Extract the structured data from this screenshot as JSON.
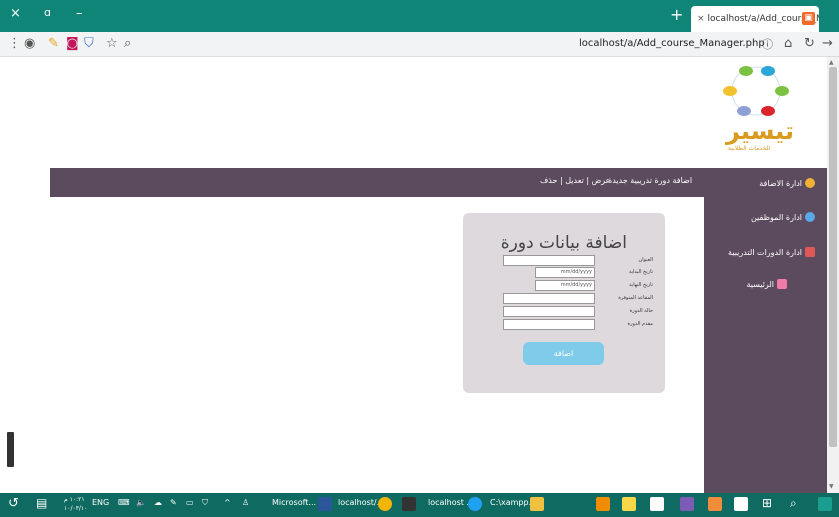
{
  "browser": {
    "tab_close": "×",
    "tab_title": "localhost/a/Add_course_Manage",
    "new_tab": "+",
    "url": "localhost/a/Add_course_Manager.php",
    "win_close": "×",
    "win_restore": "ɑ",
    "win_min": "–"
  },
  "logo": {
    "text": "تيسير",
    "subtitle": "للخدمات الطلابية"
  },
  "nav": {
    "add_course": "اضافة دورة تدريبية جديدة",
    "view_edit_delete": "عرض | تعديل | حذف"
  },
  "sidebar": {
    "items": [
      {
        "label": "ادارة الاضافة",
        "icon": "user-add-icon"
      },
      {
        "label": "ادارة الموظفين",
        "icon": "users-icon"
      },
      {
        "label": "ادارة الدورات التدريبية",
        "icon": "calendar-icon"
      },
      {
        "label": "الرئيسية",
        "icon": "home-icon"
      }
    ]
  },
  "form": {
    "title": "اضافة بيانات دورة",
    "fields": [
      {
        "label": "العنوان",
        "value": ""
      },
      {
        "label": "تاريخ البداية",
        "value": "mm/dd/yyyy"
      },
      {
        "label": "تاريخ النهاية",
        "value": "mm/dd/yyyy"
      },
      {
        "label": "المقاعد المتوفرة",
        "value": ""
      },
      {
        "label": "حالة الدورة",
        "value": ""
      },
      {
        "label": "مقدم الدورة",
        "value": ""
      }
    ],
    "submit": "اضافة"
  },
  "taskbar": {
    "time": "١٠:٢١ م",
    "date": "١٠/٠٣/١٠",
    "lang": "ENG",
    "apps": [
      "Microsoft...",
      "localhost/...",
      "localhost ...",
      "C:\\xampp..."
    ]
  },
  "colors": {
    "titlebar": "#0f8577",
    "nav": "#5c4a5e",
    "form_bg": "#ddd9dd",
    "button": "#7ecbea"
  }
}
